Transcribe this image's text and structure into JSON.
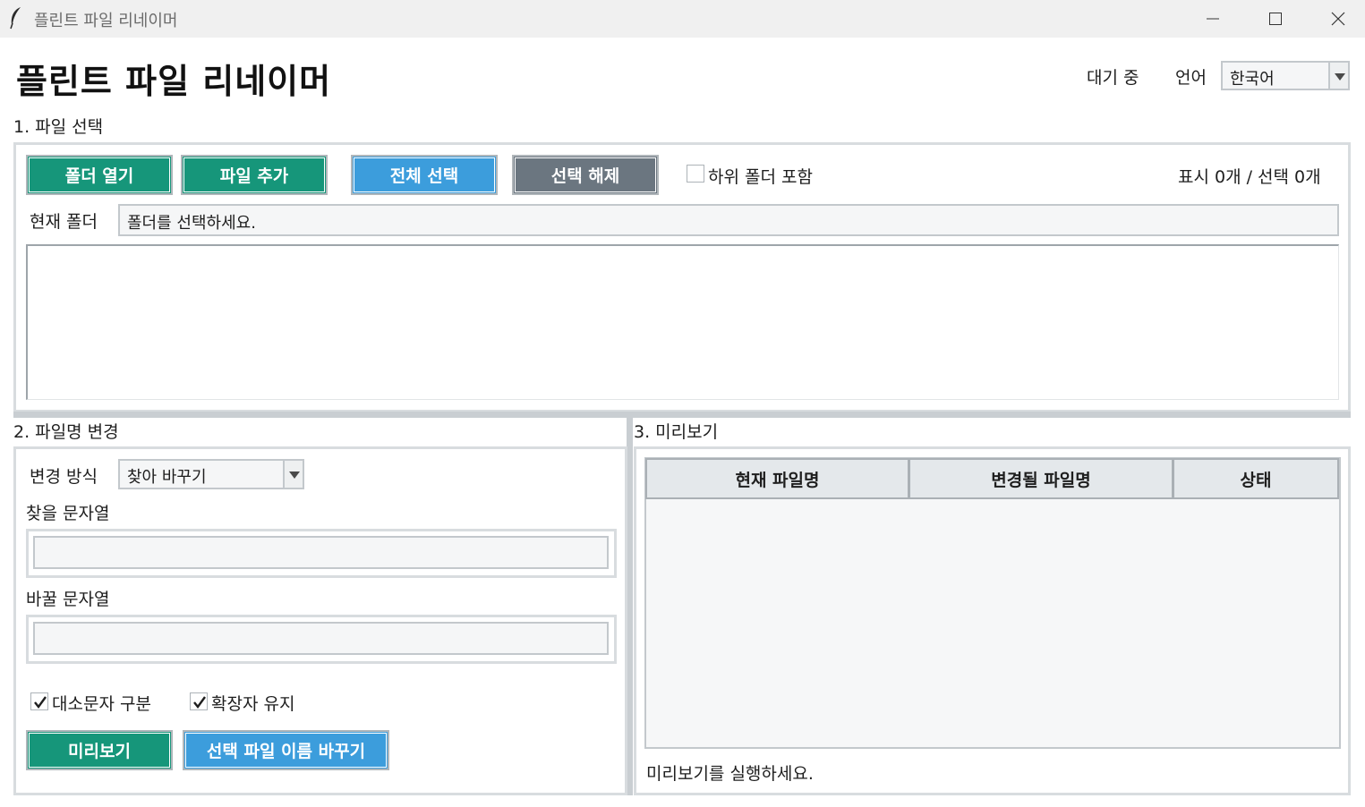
{
  "window": {
    "title": "플린트 파일 리네이머"
  },
  "header": {
    "title": "플린트 파일 리네이머",
    "status": "대기 중",
    "language_label": "언어",
    "language_value": "한국어"
  },
  "file_select": {
    "section_label": "1. 파일 선택",
    "open_folder": "폴더 열기",
    "add_file": "파일 추가",
    "select_all": "전체 선택",
    "deselect": "선택 해제",
    "include_subfolders": "하위 폴더 포함",
    "include_subfolders_checked": false,
    "counts": "표시 0개 / 선택 0개",
    "current_folder_label": "현재 폴더",
    "current_folder_value": "폴더를 선택하세요."
  },
  "rename": {
    "section_label": "2. 파일명 변경",
    "mode_label": "변경 방식",
    "mode_value": "찾아 바꾸기",
    "find_label": "찾을 문자열",
    "find_value": "",
    "replace_label": "바꿀 문자열",
    "replace_value": "",
    "case_sensitive": "대소문자 구분",
    "case_sensitive_checked": true,
    "keep_extension": "확장자 유지",
    "keep_extension_checked": true,
    "preview_button": "미리보기",
    "rename_button": "선택 파일 이름 바꾸기"
  },
  "preview": {
    "section_label": "3. 미리보기",
    "columns": [
      "현재 파일명",
      "변경될 파일명",
      "상태"
    ],
    "rows": [],
    "status_text": "미리보기를 실행하세요."
  },
  "colors": {
    "green": "#16967a",
    "blue": "#3c9ddc",
    "gray": "#6b7680"
  }
}
